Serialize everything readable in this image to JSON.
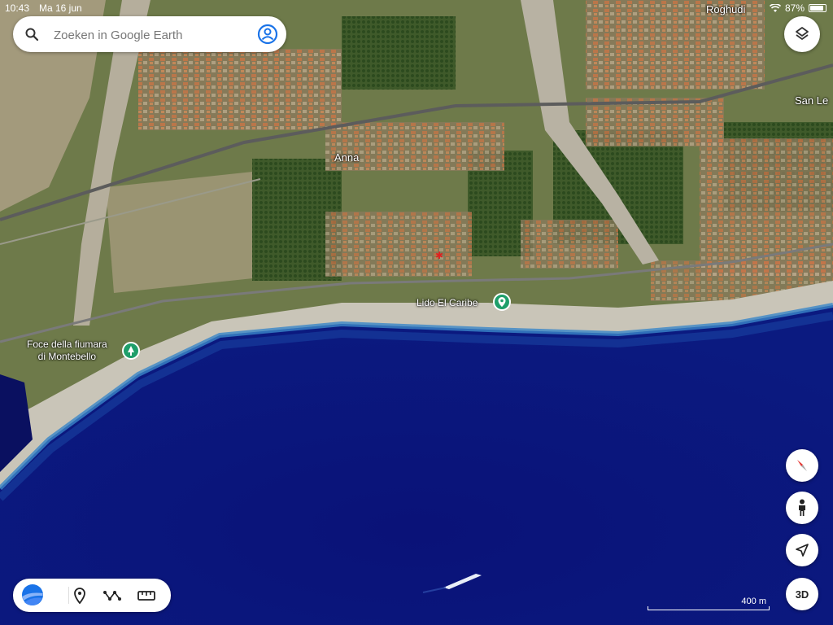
{
  "status_bar": {
    "time": "10:43",
    "date": "Ma 16 jun",
    "battery": "87%",
    "battery_level": 0.87
  },
  "search": {
    "placeholder": "Zoeken in Google Earth"
  },
  "map_labels": {
    "place_roghudi": "Roghudi",
    "place_san_le": "San Le",
    "place_anna": "Anna",
    "poi_lido": "Lido El Caribe",
    "poi_foce_line1": "Foce della fiumara",
    "poi_foce_line2": "di Montebello"
  },
  "controls": {
    "layers": "layers-icon",
    "compass": "compass-icon",
    "street_view": "pegman-icon",
    "my_location": "my-location-icon",
    "view_3d": "3D"
  },
  "toolbar": {
    "logo": "google-earth-logo",
    "placemark": "add-placemark-icon",
    "path": "draw-path-icon",
    "measure": "ruler-icon"
  },
  "scale_bar": {
    "label": "400 m"
  },
  "colors": {
    "sea": "#0a1470",
    "land": "#6e7a4a",
    "beach": "#c9c5b8",
    "pin": "#1e9e6a"
  }
}
